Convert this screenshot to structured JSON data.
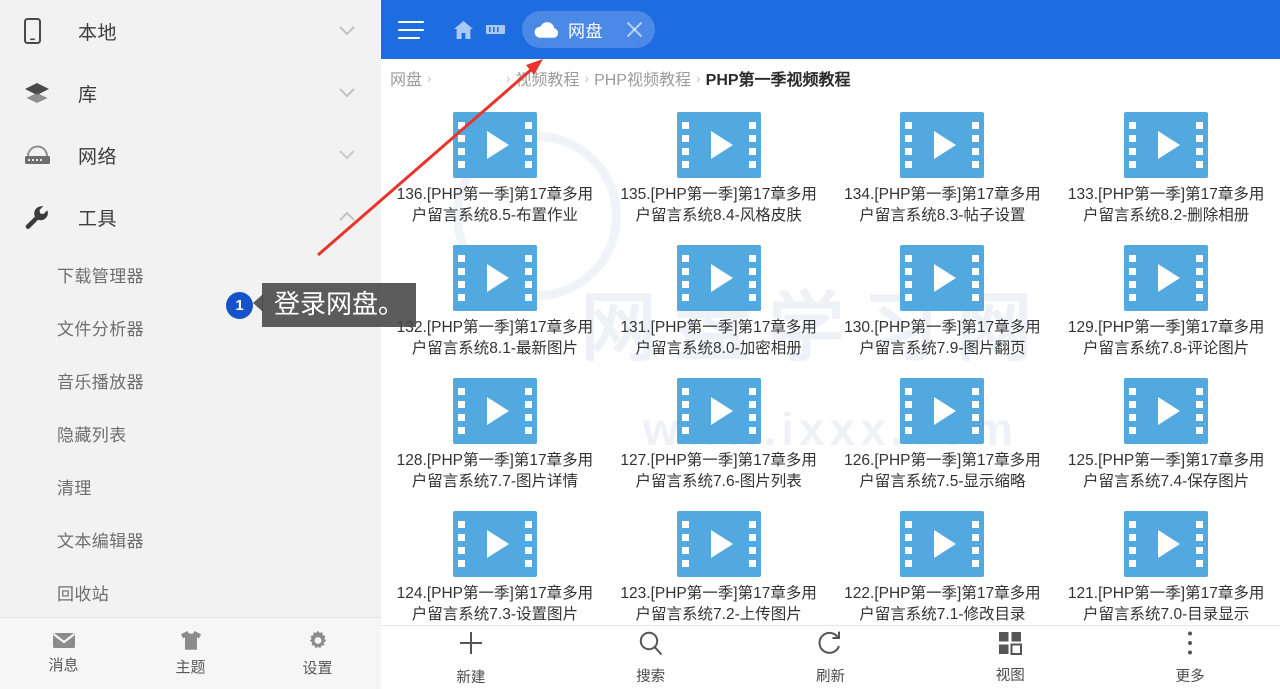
{
  "sidebar": {
    "groups": [
      {
        "label": "本地",
        "icon": "phone-icon",
        "expanded": false
      },
      {
        "label": "库",
        "icon": "layers-icon",
        "expanded": false
      },
      {
        "label": "网络",
        "icon": "router-icon",
        "expanded": false
      },
      {
        "label": "工具",
        "icon": "wrench-icon",
        "expanded": true
      }
    ],
    "tools_items": [
      "下载管理器",
      "文件分析器",
      "音乐播放器",
      "隐藏列表",
      "清理",
      "文本编辑器",
      "回收站"
    ],
    "tabs": [
      {
        "label": "消息",
        "icon": "mail-icon"
      },
      {
        "label": "主题",
        "icon": "tshirt-icon"
      },
      {
        "label": "设置",
        "icon": "gear-icon"
      }
    ]
  },
  "titlebar": {
    "menu_icon": "hamburger-icon",
    "home_icon": "home-icon",
    "apps_icon": "apps-icon",
    "tab": {
      "icon": "cloud-icon",
      "title": "网盘",
      "close": "×"
    },
    "accent": "#1d6ce0"
  },
  "breadcrumb": {
    "items": [
      "网盘",
      "　　　　",
      "视频教程",
      "PHP视频教程",
      "PHP第一季视频教程"
    ],
    "separator": "›",
    "blurred_index": 1,
    "current_index": 4
  },
  "watermark": {
    "line1": "网盘学习网",
    "line2": "www.ixxx.com"
  },
  "files": [
    {
      "name": "136.[PHP第一季]第17章多用户留言系统8.5-布置作业",
      "icon": "video-file-icon"
    },
    {
      "name": "135.[PHP第一季]第17章多用户留言系统8.4-风格皮肤",
      "icon": "video-file-icon"
    },
    {
      "name": "134.[PHP第一季]第17章多用户留言系统8.3-帖子设置",
      "icon": "video-file-icon"
    },
    {
      "name": "133.[PHP第一季]第17章多用户留言系统8.2-删除相册",
      "icon": "video-file-icon"
    },
    {
      "name": "132.[PHP第一季]第17章多用户留言系统8.1-最新图片",
      "icon": "video-file-icon"
    },
    {
      "name": "131.[PHP第一季]第17章多用户留言系统8.0-加密相册",
      "icon": "video-file-icon"
    },
    {
      "name": "130.[PHP第一季]第17章多用户留言系统7.9-图片翻页",
      "icon": "video-file-icon"
    },
    {
      "name": "129.[PHP第一季]第17章多用户留言系统7.8-评论图片",
      "icon": "video-file-icon"
    },
    {
      "name": "128.[PHP第一季]第17章多用户留言系统7.7-图片详情",
      "icon": "video-file-icon"
    },
    {
      "name": "127.[PHP第一季]第17章多用户留言系统7.6-图片列表",
      "icon": "video-file-icon"
    },
    {
      "name": "126.[PHP第一季]第17章多用户留言系统7.5-显示缩略",
      "icon": "video-file-icon"
    },
    {
      "name": "125.[PHP第一季]第17章多用户留言系统7.4-保存图片",
      "icon": "video-file-icon"
    },
    {
      "name": "124.[PHP第一季]第17章多用户留言系统7.3-设置图片",
      "icon": "video-file-icon"
    },
    {
      "name": "123.[PHP第一季]第17章多用户留言系统7.2-上传图片",
      "icon": "video-file-icon"
    },
    {
      "name": "122.[PHP第一季]第17章多用户留言系统7.1-修改目录",
      "icon": "video-file-icon"
    },
    {
      "name": "121.[PHP第一季]第17章多用户留言系统7.0-目录显示",
      "icon": "video-file-icon"
    }
  ],
  "bottombar": [
    {
      "label": "新建",
      "icon": "plus-icon"
    },
    {
      "label": "搜索",
      "icon": "search-icon"
    },
    {
      "label": "刷新",
      "icon": "refresh-icon"
    },
    {
      "label": "视图",
      "icon": "grid-view-icon"
    },
    {
      "label": "更多",
      "icon": "more-vertical-icon"
    }
  ],
  "annotation": {
    "badge": "1",
    "text": "登录网盘。",
    "arrow_color": "#e8352c"
  }
}
